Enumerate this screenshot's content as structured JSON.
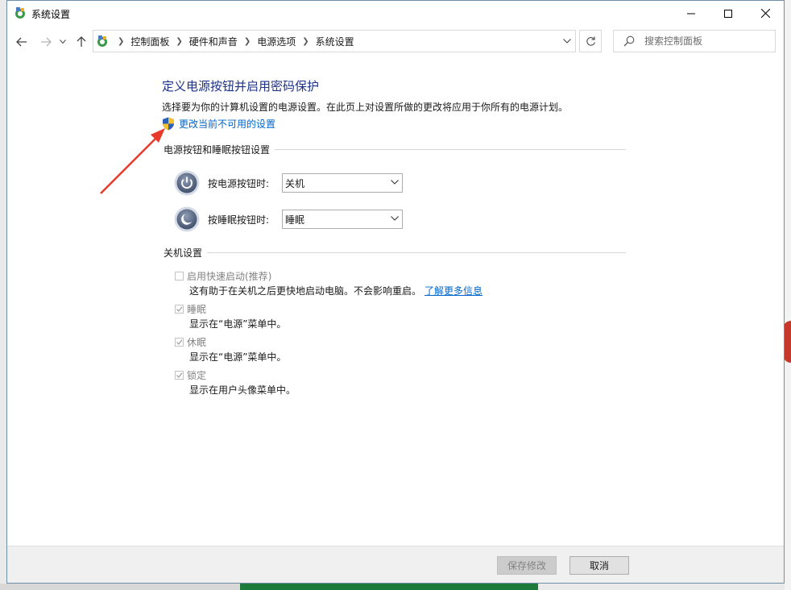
{
  "window": {
    "title": "系统设置"
  },
  "address": {
    "crumbs": [
      "控制面板",
      "硬件和声音",
      "电源选项",
      "系统设置"
    ]
  },
  "search": {
    "placeholder": "搜索控制面板"
  },
  "page": {
    "title": "定义电源按钮并启用密码保护",
    "description": "选择要为你的计算机设置的电源设置。在此页上对设置所做的更改将应用于你所有的电源计划。",
    "change_link": "更改当前不可用的设置"
  },
  "power_section": {
    "heading": "电源按钮和睡眠按钮设置",
    "power_button": {
      "label": "按电源按钮时:",
      "value": "关机"
    },
    "sleep_button": {
      "label": "按睡眠按钮时:",
      "value": "睡眠"
    }
  },
  "shutdown_section": {
    "heading": "关机设置",
    "options": [
      {
        "label": "启用快速启动(推荐)",
        "desc": "这有助于在关机之后更快地启动电脑。不会影响重启。",
        "link": "了解更多信息",
        "checked": false
      },
      {
        "label": "睡眠",
        "desc": "显示在“电源”菜单中。",
        "checked": true
      },
      {
        "label": "休眠",
        "desc": "显示在“电源”菜单中。",
        "checked": true
      },
      {
        "label": "锁定",
        "desc": "显示在用户头像菜单中。",
        "checked": true
      }
    ]
  },
  "footer": {
    "save_label": "保存修改",
    "cancel_label": "取消"
  },
  "colors": {
    "title_blue": "#1e3287",
    "link_blue": "#0066cc",
    "annotation_red": "#e8392b"
  }
}
